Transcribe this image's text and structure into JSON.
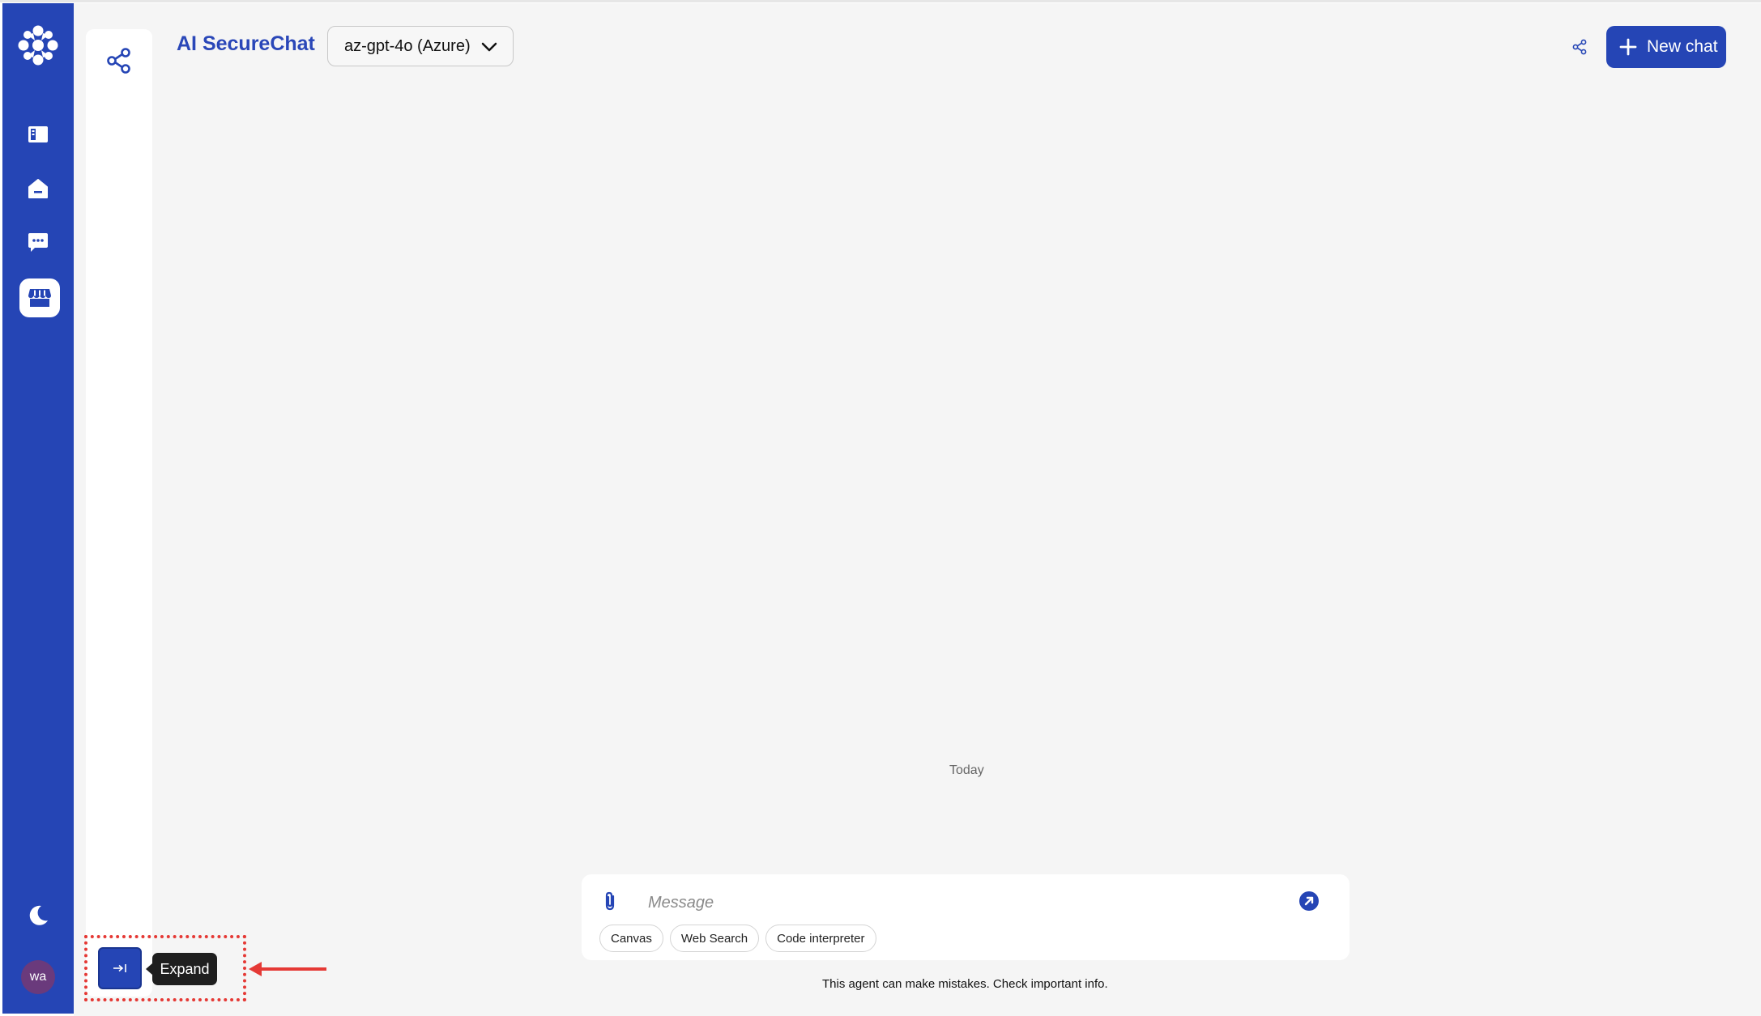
{
  "header": {
    "app_title": "AI SecureChat",
    "model": "az-gpt-4o (Azure)",
    "new_chat_label": "New chat"
  },
  "rail": {
    "items": [
      {
        "icon": "sidebar-icon"
      },
      {
        "icon": "home-icon"
      },
      {
        "icon": "chat-bubble-icon"
      },
      {
        "icon": "store-icon",
        "active": true
      }
    ],
    "avatar_initials": "wa"
  },
  "conversation": {
    "date_divider": "Today"
  },
  "composer": {
    "placeholder": "Message",
    "tools": [
      "Canvas",
      "Web Search",
      "Code interpreter"
    ]
  },
  "disclaimer": "This agent can make mistakes. Check important info.",
  "panel_toggle": {
    "tooltip": "Expand"
  },
  "colors": {
    "brand": "#2545b5",
    "annotation": "#e53935"
  }
}
